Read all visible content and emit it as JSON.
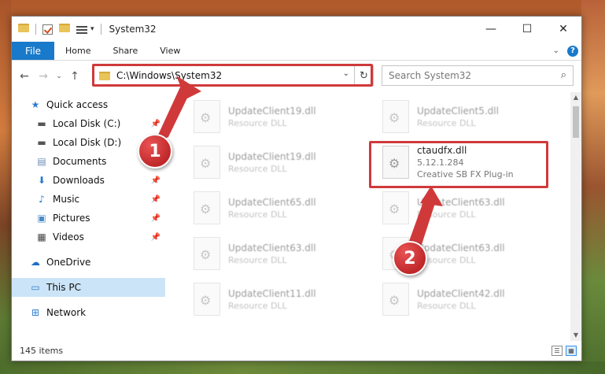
{
  "window": {
    "title": "System32"
  },
  "ribbon": {
    "file": "File",
    "home": "Home",
    "share": "Share",
    "view": "View"
  },
  "address": {
    "path": "C:\\Windows\\System32",
    "search_placeholder": "Search System32"
  },
  "sidebar": {
    "items": [
      {
        "label": "Quick access",
        "icon": "star-icon"
      },
      {
        "label": "Local Disk (C:)",
        "icon": "drive-icon"
      },
      {
        "label": "Local Disk (D:)",
        "icon": "drive-icon"
      },
      {
        "label": "Documents",
        "icon": "documents-icon"
      },
      {
        "label": "Downloads",
        "icon": "downloads-icon"
      },
      {
        "label": "Music",
        "icon": "music-icon"
      },
      {
        "label": "Pictures",
        "icon": "pictures-icon"
      },
      {
        "label": "Videos",
        "icon": "videos-icon"
      },
      {
        "label": "OneDrive",
        "icon": "cloud-icon"
      },
      {
        "label": "This PC",
        "icon": "computer-icon"
      },
      {
        "label": "Network",
        "icon": "network-icon"
      }
    ]
  },
  "files": [
    {
      "name": "UpdateClient19.dll",
      "sub": "Resource DLL"
    },
    {
      "name": "UpdateClient5.dll",
      "sub": "Resource DLL"
    },
    {
      "name": "UpdateClient19.dll",
      "sub": "Resource DLL"
    },
    {
      "name": "ctaudfx.dll",
      "sub": "5.12.1.284",
      "sub2": "Creative SB FX Plug-in"
    },
    {
      "name": "UpdateClient65.dll",
      "sub": "Resource DLL"
    },
    {
      "name": "UpdateClient63.dll",
      "sub": "Resource DLL"
    },
    {
      "name": "UpdateClient63.dll",
      "sub": "Resource DLL"
    },
    {
      "name": "UpdateClient63.dll",
      "sub": "Resource DLL"
    },
    {
      "name": "UpdateClient11.dll",
      "sub": "Resource DLL"
    },
    {
      "name": "UpdateClient42.dll",
      "sub": "Resource DLL"
    }
  ],
  "status": {
    "items": "145 items"
  },
  "annotations": {
    "one": "1",
    "two": "2"
  },
  "colors": {
    "accent": "#1979ca",
    "annotation": "#d0393a",
    "selected": "#cce4f7"
  }
}
